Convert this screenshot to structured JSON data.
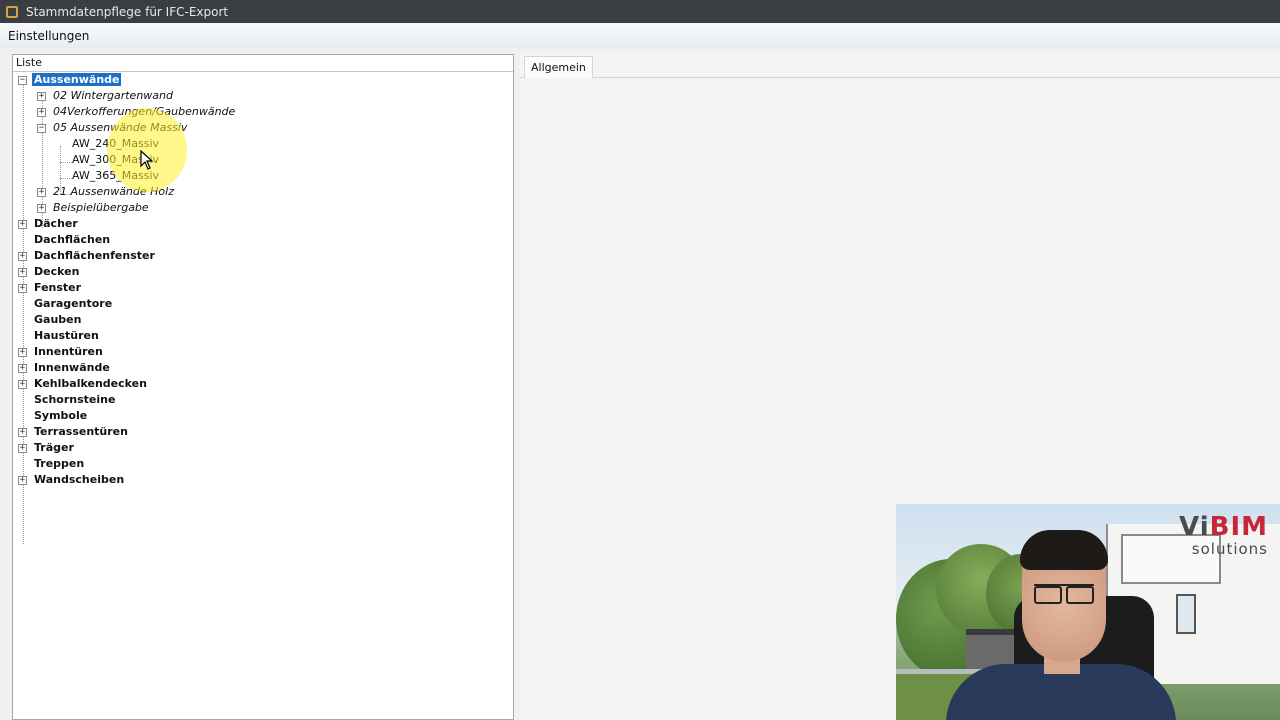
{
  "window": {
    "title": "Stammdatenpflege für IFC-Export"
  },
  "menu": {
    "items": [
      "Einstellungen"
    ]
  },
  "left_panel": {
    "header": "Liste"
  },
  "tree": {
    "root_selected": "Aussenwände",
    "aussenwaende_children": [
      "02 Wintergartenwand",
      "04Verkofferungen/Gaubenwände",
      "05 Aussenwände Massiv",
      "21 Aussenwände Holz",
      "Beispielübergabe"
    ],
    "massiv_children": [
      "AW_240_Massiv",
      "AW_300_Massiv",
      "AW_365_Massiv"
    ],
    "categories": [
      "Dächer",
      "Dachflächen",
      "Dachflächenfenster",
      "Decken",
      "Fenster",
      "Garagentore",
      "Gauben",
      "Haustüren",
      "Innentüren",
      "Innenwände",
      "Kehlbalkendecken",
      "Schornsteine",
      "Symbole",
      "Terrassentüren",
      "Träger",
      "Treppen",
      "Wandscheiben"
    ]
  },
  "right_panel": {
    "tab": "Allgemein"
  },
  "webcam": {
    "logo_main_a": "Vi",
    "logo_main_b": "BIM",
    "logo_sub": "solutions"
  },
  "colors": {
    "selection": "#1f6fc5",
    "highlight": "#fff028",
    "titlebar": "#3a3e42"
  }
}
